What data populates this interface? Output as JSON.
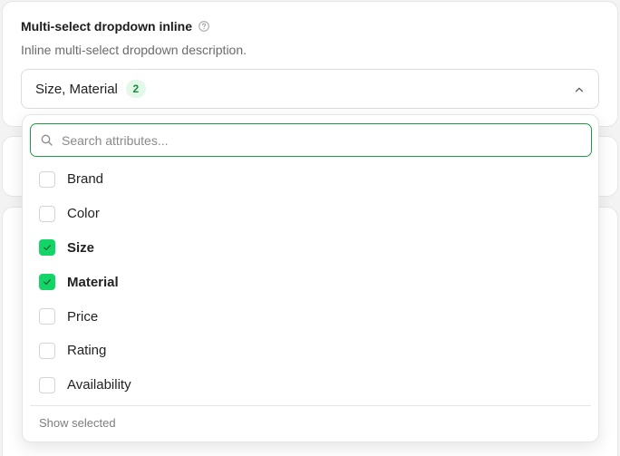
{
  "field": {
    "title": "Multi-select dropdown inline",
    "description": "Inline multi-select dropdown description."
  },
  "trigger": {
    "value": "Size, Material",
    "count": "2"
  },
  "search": {
    "placeholder": "Search attributes..."
  },
  "options": [
    {
      "label": "Brand",
      "checked": false
    },
    {
      "label": "Color",
      "checked": false
    },
    {
      "label": "Size",
      "checked": true
    },
    {
      "label": "Material",
      "checked": true
    },
    {
      "label": "Price",
      "checked": false
    },
    {
      "label": "Rating",
      "checked": false
    },
    {
      "label": "Availability",
      "checked": false
    }
  ],
  "footer": {
    "show_selected_label": "Show selected"
  },
  "colors": {
    "accent": "#13d467",
    "focus_border": "#1e9a47",
    "badge_bg": "#e2f8e8",
    "badge_text": "#1c8a3b"
  },
  "icons": {
    "help": "question-circle-icon",
    "chevron": "chevron-up-icon",
    "search": "search-icon",
    "check": "check-icon"
  }
}
